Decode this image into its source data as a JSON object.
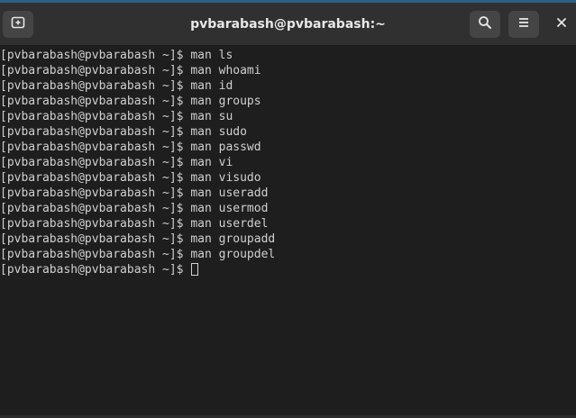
{
  "window": {
    "title": "pvbarabash@pvbarabash:~"
  },
  "headerbar": {
    "icons": {
      "new_tab": "new-tab-icon",
      "search": "search-icon",
      "menu": "hamburger-menu-icon",
      "close": "close-icon"
    }
  },
  "terminal": {
    "prompt": "[pvbarabash@pvbarabash ~]$ ",
    "lines": [
      "[pvbarabash@pvbarabash ~]$ man ls",
      "[pvbarabash@pvbarabash ~]$ man whoami",
      "[pvbarabash@pvbarabash ~]$ man id",
      "[pvbarabash@pvbarabash ~]$ man groups",
      "[pvbarabash@pvbarabash ~]$ man su",
      "[pvbarabash@pvbarabash ~]$ man sudo",
      "[pvbarabash@pvbarabash ~]$ man passwd",
      "[pvbarabash@pvbarabash ~]$ man vi",
      "[pvbarabash@pvbarabash ~]$ man visudo",
      "[pvbarabash@pvbarabash ~]$ man useradd",
      "[pvbarabash@pvbarabash ~]$ man usermod",
      "[pvbarabash@pvbarabash ~]$ man userdel",
      "[pvbarabash@pvbarabash ~]$ man groupadd",
      "[pvbarabash@pvbarabash ~]$ man groupdel"
    ],
    "current_prompt": "[pvbarabash@pvbarabash ~]$ "
  },
  "colors": {
    "terminal_bg": "#1e1e1e",
    "terminal_fg": "#d0d0d0",
    "headerbar_bg": "#303030",
    "button_bg": "#454545"
  }
}
